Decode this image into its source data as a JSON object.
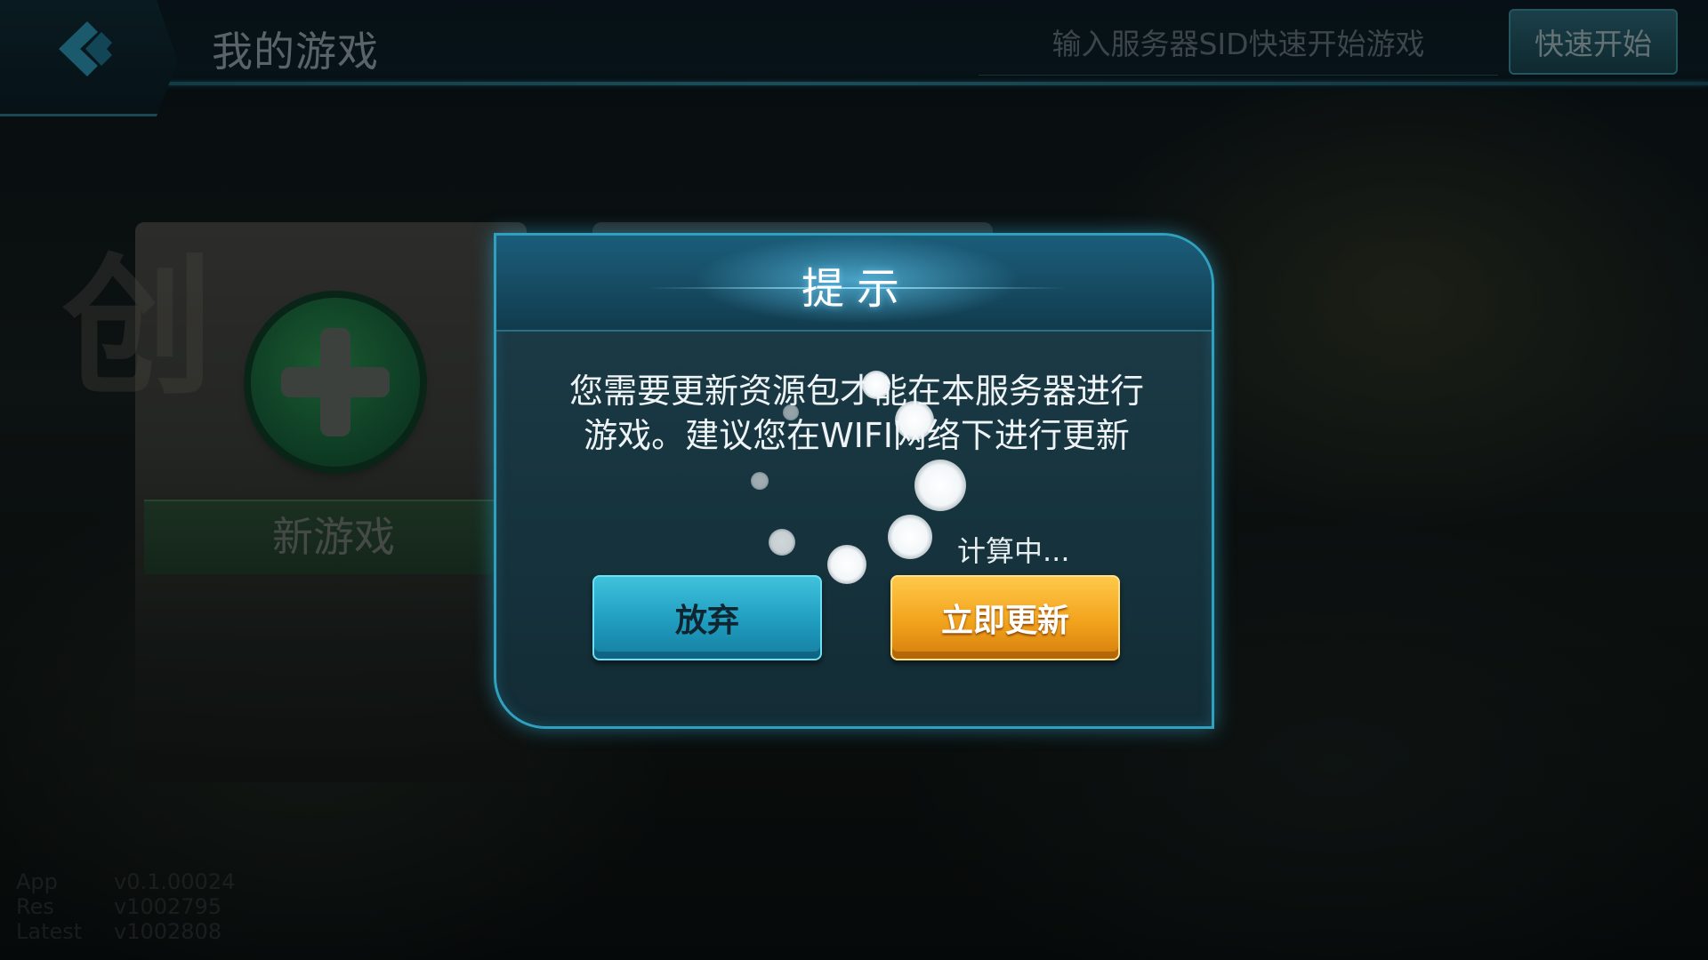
{
  "header": {
    "title": "我的游戏",
    "sid_placeholder": "输入服务器SID快速开始游戏",
    "quick_start_label": "快速开始"
  },
  "background": {
    "logo_text": "创",
    "new_game_label": "新游戏"
  },
  "version_info": [
    {
      "key": "App",
      "value": "v0.1.00024"
    },
    {
      "key": "Res",
      "value": "v1002795"
    },
    {
      "key": "Latest",
      "value": "v1002808"
    }
  ],
  "dialog": {
    "title": "提示",
    "message_line1": "您需要更新资源包才能在本服务器进行",
    "message_line2": "游戏。建议您在WIFI网络下进行更新",
    "status": "计算中...",
    "cancel_label": "放弃",
    "confirm_label": "立即更新"
  },
  "colors": {
    "dialog_border": "#2fa0be",
    "cancel_button": "#1f9cbf",
    "confirm_button": "#f2a31c",
    "add_icon": "#17603a"
  },
  "icons": {
    "back": "back-arrow-icon",
    "add": "plus-circle-icon",
    "spinner": "loading-spinner-icon"
  }
}
